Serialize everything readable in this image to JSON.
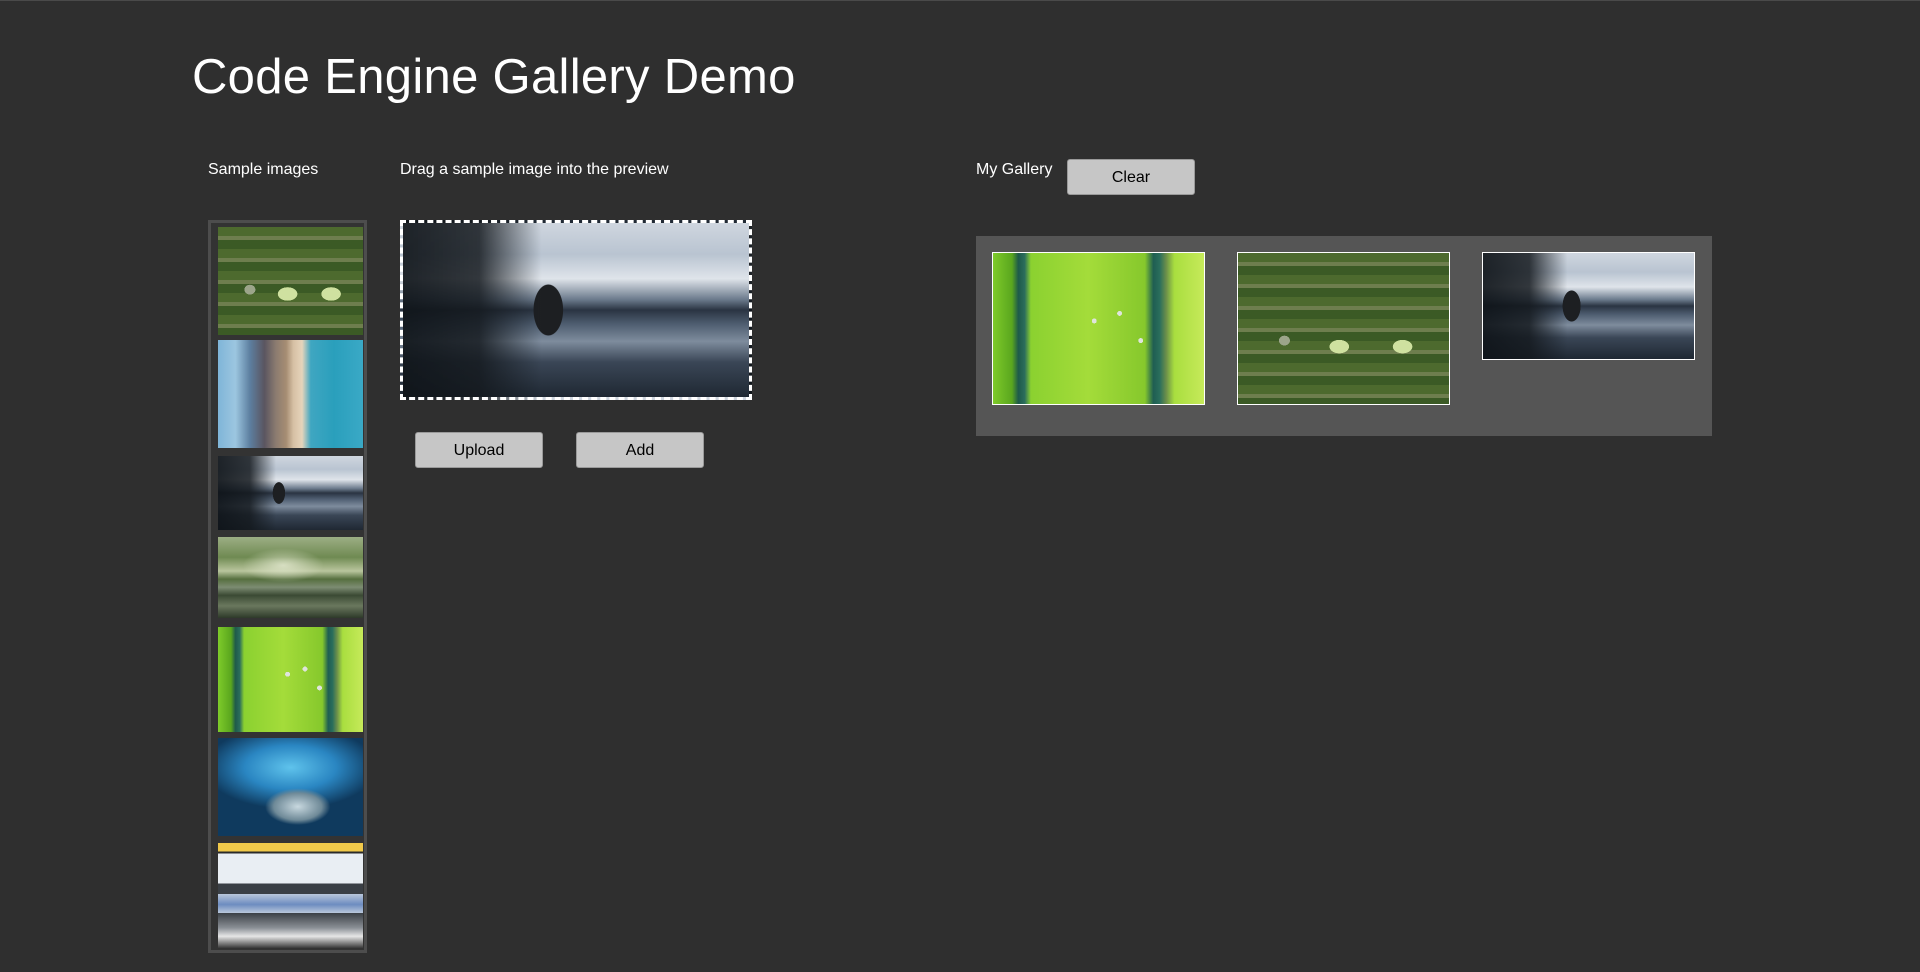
{
  "title": "Code Engine Gallery Demo",
  "labels": {
    "samples": "Sample images",
    "drag": "Drag a sample image into the preview",
    "gallery": "My Gallery"
  },
  "buttons": {
    "clear": "Clear",
    "upload": "Upload",
    "add": "Add"
  },
  "samples": [
    {
      "name": "aerial-field-vehicles"
    },
    {
      "name": "aerial-beach-shoreline"
    },
    {
      "name": "mountain-lake-window"
    },
    {
      "name": "misty-river-forest"
    },
    {
      "name": "green-crop-rows-workers"
    },
    {
      "name": "blue-ice-cave"
    },
    {
      "name": "aerial-trucks-road"
    }
  ],
  "preview": {
    "name": "mountain-lake-window"
  },
  "gallery": [
    {
      "name": "green-crop-rows-workers"
    },
    {
      "name": "aerial-field-vehicles"
    },
    {
      "name": "mountain-lake-window"
    }
  ],
  "colors": {
    "background": "#2f2f2f",
    "gallery_panel": "#555555",
    "button": "#c6c6c6"
  }
}
